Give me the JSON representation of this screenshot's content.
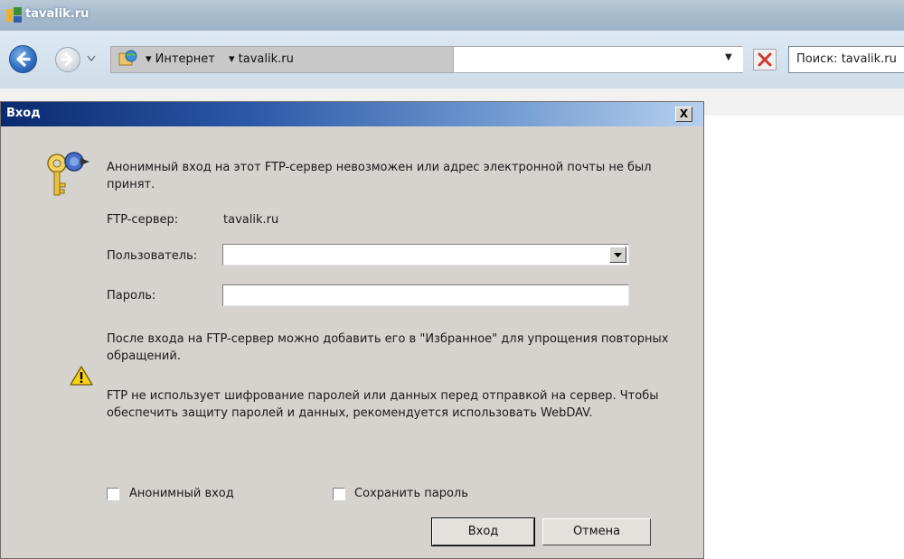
{
  "window": {
    "title": "tavalik.ru"
  },
  "address_bar": {
    "segments": [
      "Интернет",
      "tavalik.ru"
    ]
  },
  "search": {
    "text": "Поиск: tavalik.ru"
  },
  "dialog": {
    "title": "Вход",
    "close_label": "X",
    "message": "Анонимный вход на этот FTP-сервер невозможен или адрес электронной почты не был принят.",
    "server_label": "FTP-сервер:",
    "server_value": "tavalik.ru",
    "user_label": "Пользователь:",
    "user_value": "",
    "password_label": "Пароль:",
    "password_value": "",
    "favorites_note": "После входа на FTP-сервер можно добавить его в \"Избранное\" для упрощения повторных обращений.",
    "warning_text": "FTP не использует шифрование паролей или данных перед отправкой на сервер. Чтобы обеспечить защиту паролей и данных, рекомендуется использовать WebDAV.",
    "anonymous_label": "Анонимный вход",
    "anonymous_checked": false,
    "save_password_label": "Сохранить пароль",
    "save_password_checked": false,
    "login_button": "Вход",
    "cancel_button": "Отмена"
  },
  "colors": {
    "dialog_bg": "#d6d3ce",
    "title_gradient_start": "#0b2a6e",
    "title_gradient_end": "#b8d0ee",
    "toolbar_bg": "#cfdde9"
  },
  "icons": [
    "app-icon",
    "back-arrow-icon",
    "forward-arrow-icon",
    "globe-icon",
    "stop-icon",
    "keys-icon",
    "warning-icon",
    "close-icon",
    "dropdown-arrow-icon"
  ]
}
